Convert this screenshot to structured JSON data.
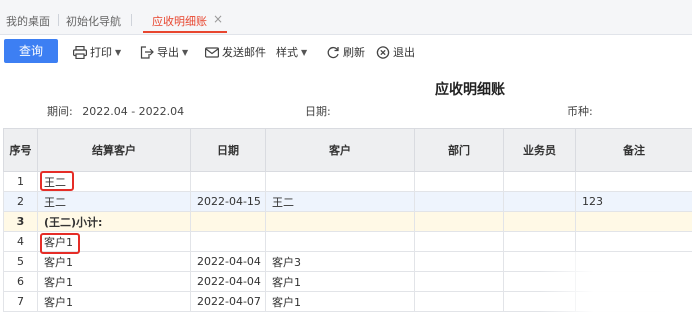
{
  "tabs": [
    {
      "label": "我的桌面"
    },
    {
      "label": "初始化导航"
    },
    {
      "label": "应收明细账",
      "active": true
    }
  ],
  "tab_close_glyph": "×",
  "toolbar": {
    "query": "查询",
    "print": "打印",
    "export": "导出",
    "send_mail": "发送邮件",
    "style": "样式",
    "refresh": "刷新",
    "exit": "退出",
    "icons": [
      "printer-icon",
      "export-icon",
      "mail-icon",
      "refresh-icon",
      "close-circle-icon"
    ]
  },
  "report": {
    "title": "应收明细账",
    "period_label": "期间:",
    "period_value": "2022.04 - 2022.04",
    "date_label": "日期:",
    "currency_label": "币种:"
  },
  "table": {
    "headers": [
      "序号",
      "结算客户",
      "日期",
      "客户",
      "部门",
      "业务员",
      "备注"
    ],
    "rows": [
      {
        "no": "1",
        "settle": "王二",
        "date": "",
        "customer": "",
        "dept": "",
        "staff": "",
        "note": ""
      },
      {
        "no": "2",
        "settle": "王二",
        "date": "2022-04-15",
        "customer": "王二",
        "dept": "",
        "staff": "",
        "note": "123"
      },
      {
        "no": "3",
        "settle": "(王二)小计:",
        "date": "",
        "customer": "",
        "dept": "",
        "staff": "",
        "note": ""
      },
      {
        "no": "4",
        "settle": "客户1",
        "date": "",
        "customer": "",
        "dept": "",
        "staff": "",
        "note": ""
      },
      {
        "no": "5",
        "settle": "客户1",
        "date": "2022-04-04",
        "customer": "客户3",
        "dept": "",
        "staff": "",
        "note": ""
      },
      {
        "no": "6",
        "settle": "客户1",
        "date": "2022-04-04",
        "customer": "客户1",
        "dept": "",
        "staff": "",
        "note": ""
      },
      {
        "no": "7",
        "settle": "客户1",
        "date": "2022-04-07",
        "customer": "客户1",
        "dept": "",
        "staff": "",
        "note": ""
      }
    ]
  },
  "colors": {
    "accent": "#3d7ff3",
    "active_tab": "#e8462f",
    "highlight": "#e52d27",
    "subtotal_bg": "#fff9e6",
    "selected_bg": "#eef4fd"
  }
}
